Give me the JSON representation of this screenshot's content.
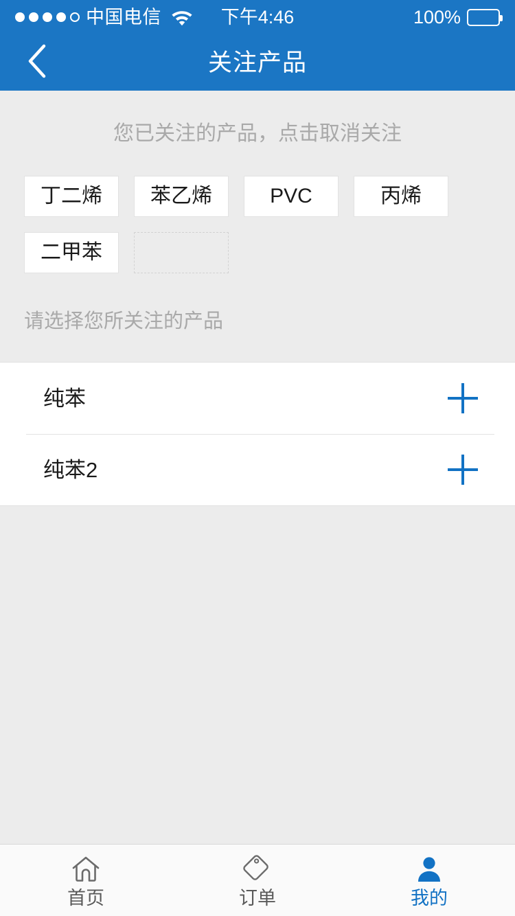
{
  "status_bar": {
    "signal_dots_filled": 4,
    "signal_dots_total": 5,
    "carrier": "中国电信",
    "wifi_icon": "wifi-icon",
    "time": "下午4:46",
    "battery_percent": "100%",
    "battery_level": 100
  },
  "nav_bar": {
    "back_icon": "chevron-left-icon",
    "title": "关注产品",
    "background_color": "#1b76c4"
  },
  "followed": {
    "hint": "您已关注的产品，点击取消关注",
    "tags": [
      {
        "label": "丁二烯"
      },
      {
        "label": "苯乙烯"
      },
      {
        "label": "PVC"
      },
      {
        "label": "丙烯"
      },
      {
        "label": "二甲苯"
      }
    ],
    "placeholder_slots": 1
  },
  "available": {
    "section_label": "请选择您所关注的产品",
    "items": [
      {
        "name": "纯苯",
        "action_icon": "plus-icon"
      },
      {
        "name": "纯苯2",
        "action_icon": "plus-icon"
      }
    ]
  },
  "tab_bar": {
    "active_color": "#1272c4",
    "inactive_color": "#5a5a5a",
    "tabs": [
      {
        "label": "首页",
        "icon": "home-icon",
        "active": false
      },
      {
        "label": "订单",
        "icon": "tag-icon",
        "active": false
      },
      {
        "label": "我的",
        "icon": "person-icon",
        "active": true
      }
    ]
  }
}
